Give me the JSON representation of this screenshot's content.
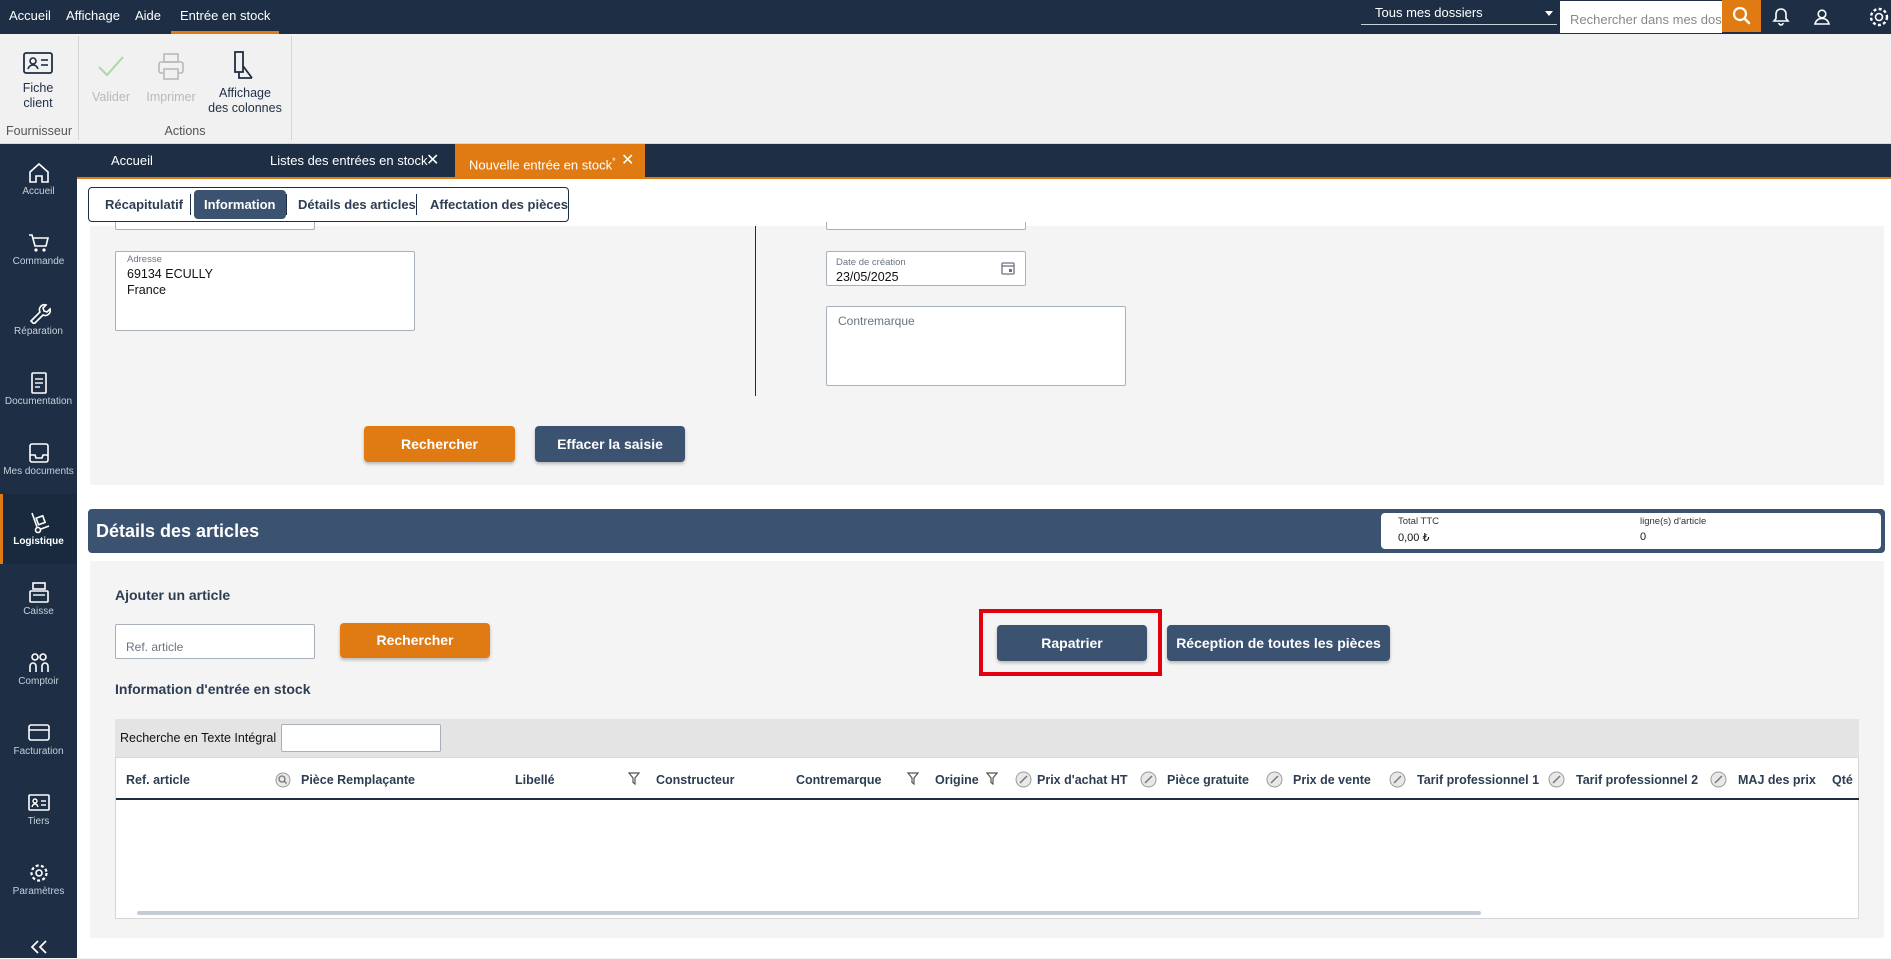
{
  "topbar": {
    "menu": [
      "Accueil",
      "Affichage",
      "Aide",
      "Entrée en stock"
    ],
    "folder_select": "Tous mes dossiers",
    "search_placeholder": "Rechercher dans mes dossiers"
  },
  "ribbon": {
    "groups": [
      {
        "label": "Fournisseur",
        "buttons": [
          {
            "label": "Fiche client",
            "enabled": true
          }
        ]
      },
      {
        "label": "Actions",
        "buttons": [
          {
            "label": "Valider",
            "enabled": false
          },
          {
            "label": "Imprimer",
            "enabled": false
          },
          {
            "label": "Affichage des colonnes",
            "enabled": true
          }
        ]
      }
    ]
  },
  "sidenav": [
    {
      "label": "Accueil",
      "icon": "home-icon"
    },
    {
      "label": "Commande",
      "icon": "cart-icon"
    },
    {
      "label": "Réparation",
      "icon": "wrench-icon"
    },
    {
      "label": "Documentation",
      "icon": "document-icon"
    },
    {
      "label": "Mes documents",
      "icon": "inbox-icon"
    },
    {
      "label": "Logistique",
      "icon": "hand-truck-icon",
      "active": true
    },
    {
      "label": "Caisse",
      "icon": "cash-register-icon"
    },
    {
      "label": "Comptoir",
      "icon": "people-icon"
    },
    {
      "label": "Facturation",
      "icon": "credit-card-icon"
    },
    {
      "label": "Tiers",
      "icon": "id-card-icon"
    },
    {
      "label": "Paramètres",
      "icon": "gear-icon"
    }
  ],
  "doc_tabs": [
    {
      "label": "Accueil"
    },
    {
      "label": "Listes des entrées en stock",
      "closable": true
    },
    {
      "label": "Nouvelle entrée en stock",
      "modified_marker": "*",
      "closable": true,
      "active": true
    }
  ],
  "subtabs": [
    "Récapitulatif",
    "Information",
    "Détails des articles",
    "Affectation des pièces"
  ],
  "info": {
    "adresse_label": "Adresse",
    "adresse_line1": "69134 ECULLY",
    "adresse_line2": "France",
    "date_creation_label": "Date de création",
    "date_creation_value": "23/05/2025",
    "contremarque_label": "Contremarque",
    "search_button": "Rechercher",
    "clear_button": "Effacer la saisie"
  },
  "details": {
    "title": "Détails des articles",
    "total_ttc_label": "Total TTC",
    "total_ttc_value": "0,00 ₺",
    "lignes_label": "ligne(s) d'article",
    "lignes_value": "0",
    "add_article_title": "Ajouter un article",
    "ref_placeholder": "Ref. article",
    "search_button": "Rechercher",
    "rapatrier_button": "Rapatrier",
    "reception_button": "Réception de toutes les pièces",
    "stock_info_title": "Information d'entrée en stock",
    "fulltext_label": "Recherche en Texte Intégral",
    "fulltext_value": ""
  },
  "grid": {
    "columns": [
      "Ref. article",
      "Pièce Remplaçante",
      "Libellé",
      "Constructeur",
      "Contremarque",
      "Origine",
      "Prix d'achat HT",
      "Pièce gratuite",
      "Prix de vente",
      "Tarif professionnel 1",
      "Tarif professionnel 2",
      "MAJ des prix",
      "Qté"
    ],
    "rows": []
  },
  "colors": {
    "navy": "#1e2f45",
    "slate": "#3b5270",
    "orange": "#e07a12",
    "highlight": "#e3000f"
  }
}
